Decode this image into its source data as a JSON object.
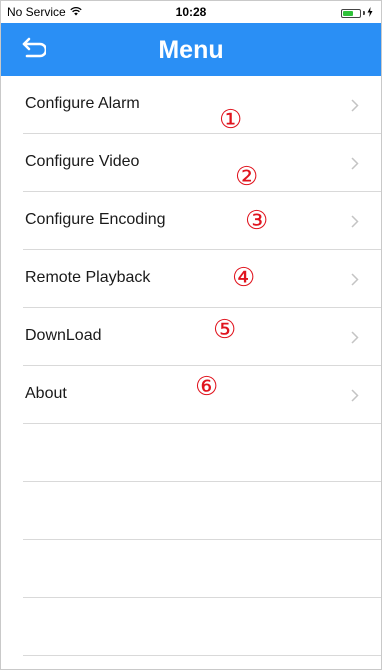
{
  "status_bar": {
    "carrier": "No Service",
    "time": "10:28",
    "battery_level": 0.6,
    "icons": [
      "wifi-icon",
      "battery-icon",
      "charging-icon"
    ]
  },
  "nav_bar": {
    "title": "Menu",
    "back_icon": "back-arrow-icon",
    "background_color": "#2a8ff5"
  },
  "menu": {
    "items": [
      {
        "label": "Configure Alarm",
        "marker": "①"
      },
      {
        "label": "Configure Video",
        "marker": "②"
      },
      {
        "label": "Configure Encoding",
        "marker": "③"
      },
      {
        "label": "Remote Playback",
        "marker": "④"
      },
      {
        "label": "DownLoad",
        "marker": "⑤"
      },
      {
        "label": "About",
        "marker": "⑥"
      }
    ],
    "marker_color": "#e0141e",
    "chevron_icon": "chevron-right-icon"
  }
}
